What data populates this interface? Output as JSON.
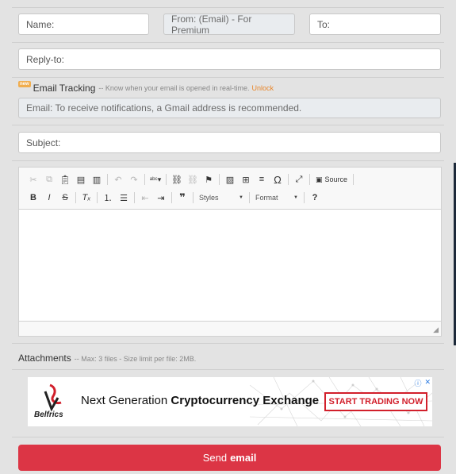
{
  "form": {
    "name_placeholder": "Name:",
    "from_placeholder": "From: (Email) - For Premium",
    "to_placeholder": "To:",
    "replyto_placeholder": "Reply-to:",
    "subject_placeholder": "Subject:"
  },
  "tracking": {
    "badge": "new",
    "title": "Email Tracking",
    "description": "-- Know when your email is opened in real-time.",
    "unlock": "Unlock",
    "email_placeholder": "Email: To receive notifications, a Gmail address is recommended."
  },
  "toolbar": {
    "source_label": "Source",
    "styles_label": "Styles",
    "format_label": "Format",
    "icons": [
      "cut-icon",
      "copy-icon",
      "paste-icon",
      "paste-text-icon",
      "paste-word-icon",
      "undo-icon",
      "redo-icon",
      "spellcheck-icon",
      "link-icon",
      "unlink-icon",
      "anchor-icon",
      "image-icon",
      "table-icon",
      "horizontal-line-icon",
      "special-char-icon",
      "maximize-icon",
      "source-icon",
      "bold-icon",
      "italic-icon",
      "strike-icon",
      "remove-format-icon",
      "numbered-list-icon",
      "bulleted-list-icon",
      "outdent-icon",
      "indent-icon",
      "blockquote-icon",
      "help-icon"
    ]
  },
  "attachments": {
    "label": "Attachments",
    "note": "-- Max: 3 files - Size limit per file: 2MB."
  },
  "ad": {
    "brand": "Belfrics",
    "headline_prefix": "Next Generation ",
    "headline_bold": "Cryptocurrency Exchange",
    "cta": "START TRADING NOW"
  },
  "send": {
    "prefix": "Send",
    "bold": "email",
    "color": "#dc3545"
  }
}
